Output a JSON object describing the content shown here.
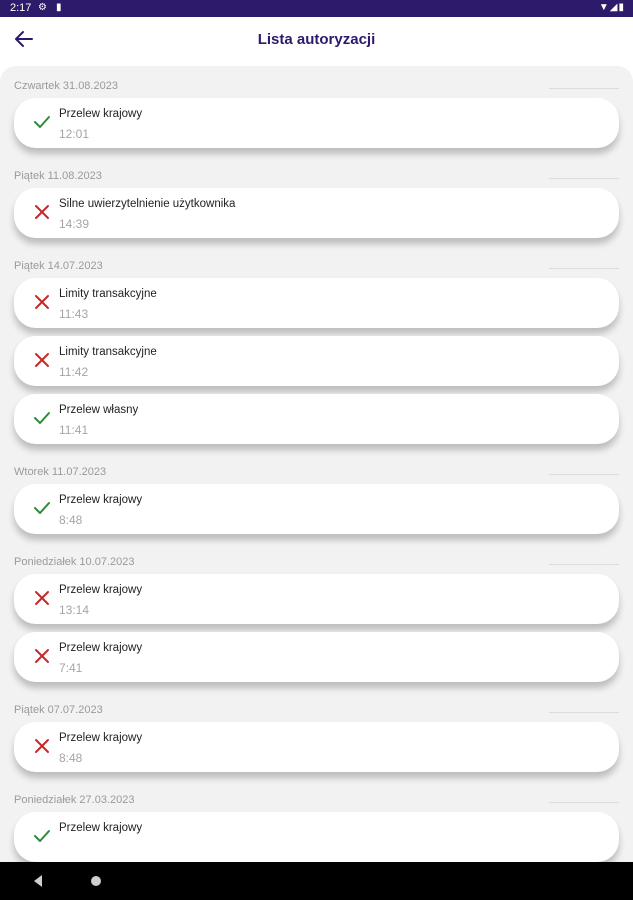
{
  "status_bar": {
    "time": "2:17",
    "icons": [
      "gear-icon",
      "sim-icon",
      "wifi-icon",
      "signal-icon",
      "battery-icon"
    ]
  },
  "header": {
    "title": "Lista autoryzacji",
    "back_icon": "arrow-left-icon"
  },
  "colors": {
    "accent": "#2e1a6b",
    "success": "#2e8b3d",
    "error": "#c62828",
    "panel": "#f2f2f2"
  },
  "groups": [
    {
      "date": "Czwartek 31.08.2023",
      "items": [
        {
          "title": "Przelew krajowy",
          "time": "12:01",
          "status": "success"
        }
      ]
    },
    {
      "date": "Piątek 11.08.2023",
      "items": [
        {
          "title": "Silne uwierzytelnienie użytkownika",
          "time": "14:39",
          "status": "error"
        }
      ]
    },
    {
      "date": "Piątek 14.07.2023",
      "items": [
        {
          "title": "Limity transakcyjne",
          "time": "11:43",
          "status": "error"
        },
        {
          "title": "Limity transakcyjne",
          "time": "11:42",
          "status": "error"
        },
        {
          "title": "Przelew własny",
          "time": "11:41",
          "status": "success"
        }
      ]
    },
    {
      "date": "Wtorek 11.07.2023",
      "items": [
        {
          "title": "Przelew krajowy",
          "time": "8:48",
          "status": "success"
        }
      ]
    },
    {
      "date": "Poniedziałek 10.07.2023",
      "items": [
        {
          "title": "Przelew krajowy",
          "time": "13:14",
          "status": "error"
        },
        {
          "title": "Przelew krajowy",
          "time": "7:41",
          "status": "error"
        }
      ]
    },
    {
      "date": "Piątek 07.07.2023",
      "items": [
        {
          "title": "Przelew krajowy",
          "time": "8:48",
          "status": "error"
        }
      ]
    },
    {
      "date": "Poniedziałek 27.03.2023",
      "items": [
        {
          "title": "Przelew krajowy",
          "time": "",
          "status": "success"
        }
      ]
    }
  ],
  "nav_bar": {
    "icons": [
      "back-triangle-icon",
      "home-circle-icon"
    ]
  }
}
